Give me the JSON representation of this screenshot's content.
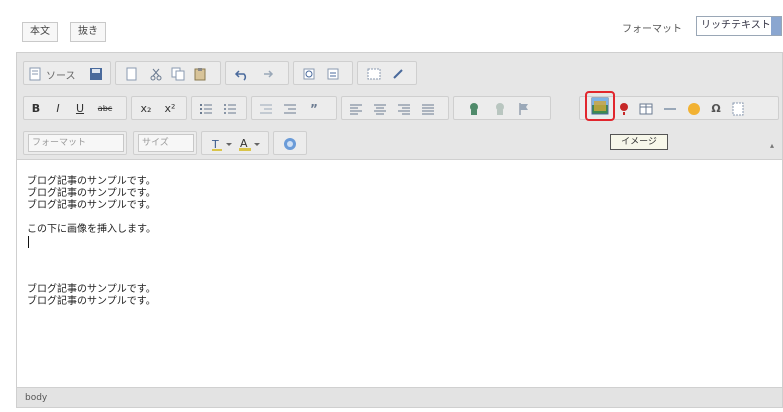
{
  "tabs": [
    {
      "label": "本文"
    },
    {
      "label": "抜き"
    }
  ],
  "format": {
    "label": "フォーマット",
    "value": "リッチテキスト"
  },
  "toolbar": {
    "row1": {
      "source_label": "ソース",
      "icons": [
        "source-icon",
        "save-icon",
        "new-page-icon",
        "cut-icon",
        "copy-icon",
        "paste-icon",
        "undo-icon",
        "redo-icon",
        "find-icon",
        "replace-icon",
        "select-all-icon",
        "remove-format-icon"
      ]
    },
    "row2": {
      "bold": "B",
      "italic": "I",
      "underline": "U",
      "strike": "abc",
      "subscript": "x₂",
      "superscript": "x²",
      "icons": [
        "ordered-list-icon",
        "unordered-list-icon",
        "outdent-icon",
        "indent-icon",
        "blockquote-icon",
        "align-left-icon",
        "align-center-icon",
        "align-right-icon",
        "align-justify-icon",
        "link-icon",
        "unlink-icon",
        "anchor-icon",
        "image-icon",
        "flash-icon",
        "table-icon",
        "horizontal-rule-icon",
        "smiley-icon",
        "special-char-icon",
        "page-break-icon"
      ]
    },
    "row3": {
      "format_combo": "フォーマット",
      "size_combo": "サイズ",
      "icons": [
        "text-color-icon",
        "bg-color-icon",
        "maximize-icon"
      ]
    },
    "tooltip": "イメージ"
  },
  "content": {
    "lines_top": [
      "ブログ記事のサンプルです。",
      "ブログ記事のサンプルです。",
      "ブログ記事のサンプルです。"
    ],
    "insert_line": "この下に画像を挿入します。",
    "lines_bottom": [
      "ブログ記事のサンプルです。",
      "ブログ記事のサンプルです。"
    ]
  },
  "statusbar": {
    "path": "body"
  }
}
